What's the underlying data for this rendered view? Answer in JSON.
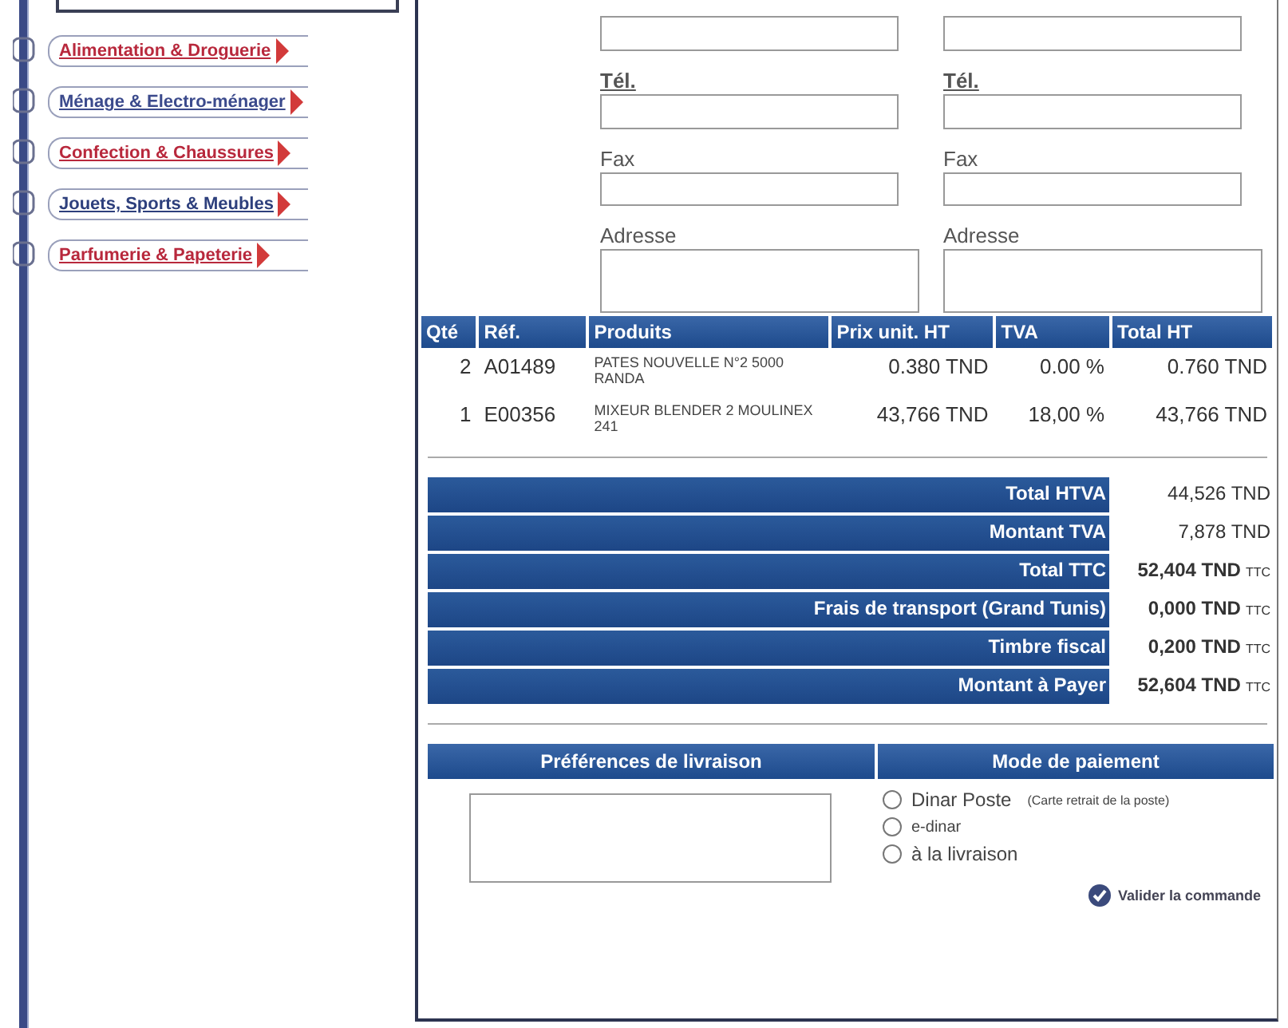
{
  "sidebar": {
    "categories": [
      {
        "label": "Alimentation & Droguerie",
        "color": "#b8283c"
      },
      {
        "label": "Ménage & Electro-ménager",
        "color": "#3b4a8c"
      },
      {
        "label": "Confection & Chaussures",
        "color": "#b8283c"
      },
      {
        "label": "Jouets, Sports & Meubles",
        "color": "#2d3f7c"
      },
      {
        "label": "Parfumerie & Papeterie",
        "color": "#b8283c"
      }
    ]
  },
  "contact_form": {
    "columns": [
      {
        "fields": [
          {
            "kind": "input"
          },
          {
            "kind": "input",
            "label": "Tél.",
            "underlined": true
          },
          {
            "kind": "input",
            "label": "Fax",
            "underlined": false
          },
          {
            "kind": "textarea",
            "label": "Adresse",
            "underlined": false
          }
        ]
      },
      {
        "fields": [
          {
            "kind": "input"
          },
          {
            "kind": "input",
            "label": "Tél.",
            "underlined": true
          },
          {
            "kind": "input",
            "label": "Fax",
            "underlined": false
          },
          {
            "kind": "textarea",
            "label": "Adresse",
            "underlined": false
          }
        ]
      }
    ]
  },
  "order_table": {
    "columns": [
      "Qté",
      "Réf.",
      "Produits",
      "Prix unit. HT",
      "TVA",
      "Total HT"
    ],
    "rows": [
      [
        "2",
        "A01489",
        "PATES NOUVELLE N°2 5000 RANDA",
        "0.380 TND",
        "0.00 %",
        "0.760 TND"
      ],
      [
        "1",
        "E00356",
        "MIXEUR BLENDER 2 MOULINEX 241",
        "43,766 TND",
        "18,00 %",
        "43,766 TND"
      ]
    ]
  },
  "totals": [
    {
      "label": "Total HTVA",
      "value": "44,526 TND"
    },
    {
      "label": "Montant TVA",
      "value": "7,878 TND"
    },
    {
      "label": "Total TTC",
      "value": "52,404 TND",
      "suffix": "TTC"
    },
    {
      "label": "Frais de transport (Grand Tunis)",
      "value": "0,000 TND",
      "suffix": "TTC"
    },
    {
      "label": "Timbre fiscal",
      "value": "0,200 TND",
      "suffix": "TTC"
    },
    {
      "label": "Montant à Payer",
      "value": "52,604 TND",
      "suffix": "TTC"
    }
  ],
  "delivery": {
    "heading": "Préférences de livraison"
  },
  "payment": {
    "heading": "Mode de paiement",
    "options": [
      {
        "label": "Dinar Poste",
        "note": "(Carte retrait de la poste)",
        "selected": false
      },
      {
        "label": "e-dinar",
        "selected": false
      },
      {
        "label": "à la livraison",
        "selected": false
      }
    ]
  },
  "validate_link": "Valider la commande"
}
